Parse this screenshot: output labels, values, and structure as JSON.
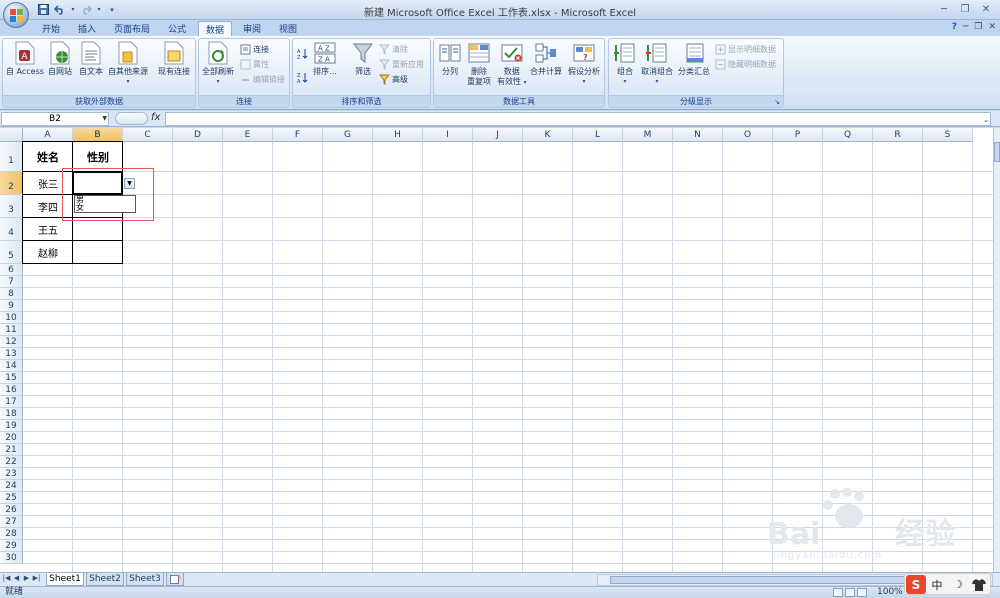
{
  "titlebar": {
    "title": "新建 Microsoft Office Excel 工作表.xlsx - Microsoft Excel",
    "qat": [
      "save-icon",
      "undo-icon",
      "redo-icon",
      "customize-icon"
    ]
  },
  "tabs": [
    {
      "label": "开始",
      "active": false
    },
    {
      "label": "插入",
      "active": false
    },
    {
      "label": "页面布局",
      "active": false
    },
    {
      "label": "公式",
      "active": false
    },
    {
      "label": "数据",
      "active": true
    },
    {
      "label": "审阅",
      "active": false
    },
    {
      "label": "视图",
      "active": false
    }
  ],
  "ribbon": {
    "ext_data": {
      "group_label": "获取外部数据",
      "access": "自 Access",
      "web": "自网站",
      "text": "自文本",
      "other": "自其他来源",
      "existing": "现有连接"
    },
    "connections": {
      "group_label": "连接",
      "refresh_all": "全部刷新",
      "connections": "连接",
      "properties": "属性",
      "edit_links": "编辑链接"
    },
    "sort_filter": {
      "group_label": "排序和筛选",
      "sort": "排序...",
      "filter": "筛选",
      "clear": "清除",
      "reapply": "重新应用",
      "advanced": "高级"
    },
    "data_tools": {
      "group_label": "数据工具",
      "text_to_columns": "分列",
      "remove_duplicates_1": "删除",
      "remove_duplicates_2": "重复项",
      "validation_1": "数据",
      "validation_2": "有效性",
      "consolidate": "合并计算",
      "what_if": "假设分析"
    },
    "outline": {
      "group_label": "分级显示",
      "group": "组合",
      "ungroup": "取消组合",
      "subtotal": "分类汇总",
      "show_detail": "显示明细数据",
      "hide_detail": "隐藏明细数据"
    }
  },
  "formula_bar": {
    "name_box": "B2",
    "fx": "fx",
    "formula": ""
  },
  "grid": {
    "columns": [
      "A",
      "B",
      "C",
      "D",
      "E",
      "F",
      "G",
      "H",
      "I",
      "J",
      "K",
      "L",
      "M",
      "N",
      "O",
      "P",
      "Q",
      "R",
      "S"
    ],
    "selected_column": "B",
    "selected_row": 2,
    "rows": [
      "1",
      "2",
      "3",
      "4",
      "5",
      "6",
      "7",
      "8",
      "9",
      "10",
      "11",
      "12",
      "13",
      "14",
      "15",
      "16",
      "17",
      "18",
      "19",
      "20",
      "21",
      "22",
      "23",
      "24",
      "25",
      "26",
      "27",
      "28",
      "29",
      "30"
    ],
    "cells": {
      "A1": "姓名",
      "B1": "性别",
      "A2": "张三",
      "A3": "李四",
      "A4": "王五",
      "A5": "赵柳"
    },
    "dropdown_options": [
      "男",
      "女"
    ]
  },
  "sheets": [
    {
      "label": "Sheet1",
      "active": true
    },
    {
      "label": "Sheet2",
      "active": false
    },
    {
      "label": "Sheet3",
      "active": false
    }
  ],
  "status": {
    "text": "就绪",
    "zoom": "100%"
  },
  "ime": {
    "lang": "中",
    "items": [
      "sogou-logo-icon",
      "moon-icon",
      "shirt-icon"
    ]
  },
  "watermark": {
    "brand": "Bai经验",
    "url": "jingyan.baidu.com"
  }
}
